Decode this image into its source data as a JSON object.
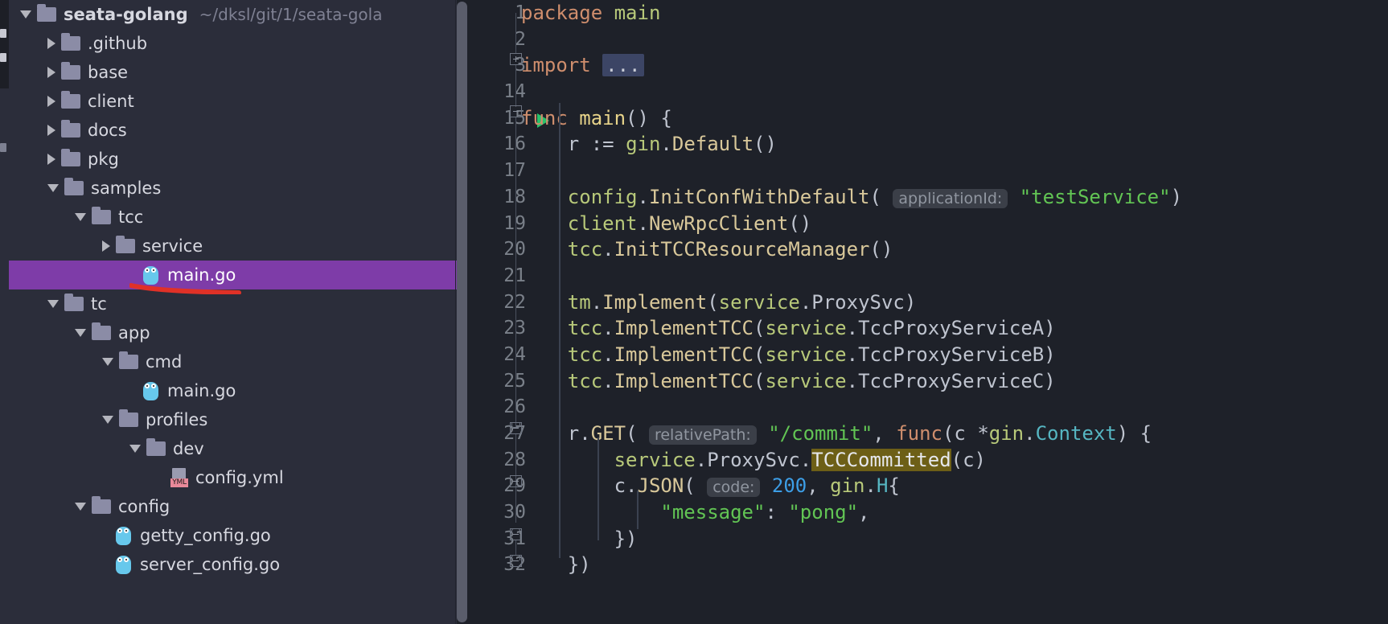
{
  "theme": {
    "sidebar_bg": "#2b2d3a",
    "editor_bg": "#1e2129",
    "selection_bg": "#7e3ca8",
    "annotation_color": "#e03127",
    "search_highlight_bg": "#6d5f17",
    "run_marker_color": "#29c36b"
  },
  "sidebar": {
    "name": "project-tree",
    "items": [
      {
        "label": "seata-golang",
        "path": "~/dksl/git/1/seata-gola",
        "type": "folder",
        "arrow": "down",
        "depth": 0,
        "bold": true,
        "selected": false
      },
      {
        "label": ".github",
        "type": "folder",
        "arrow": "right",
        "depth": 1,
        "selected": false
      },
      {
        "label": "base",
        "type": "folder",
        "arrow": "right",
        "depth": 1,
        "selected": false
      },
      {
        "label": "client",
        "type": "folder",
        "arrow": "right",
        "depth": 1,
        "selected": false
      },
      {
        "label": "docs",
        "type": "folder",
        "arrow": "right",
        "depth": 1,
        "selected": false
      },
      {
        "label": "pkg",
        "type": "folder",
        "arrow": "right",
        "depth": 1,
        "selected": false
      },
      {
        "label": "samples",
        "type": "folder",
        "arrow": "down",
        "depth": 1,
        "selected": false
      },
      {
        "label": "tcc",
        "type": "folder",
        "arrow": "down",
        "depth": 2,
        "selected": false
      },
      {
        "label": "service",
        "type": "folder",
        "arrow": "right",
        "depth": 3,
        "selected": false
      },
      {
        "label": "main.go",
        "type": "go",
        "arrow": "none",
        "depth": 4,
        "selected": true
      },
      {
        "label": "tc",
        "type": "folder",
        "arrow": "down",
        "depth": 1,
        "selected": false
      },
      {
        "label": "app",
        "type": "folder",
        "arrow": "down",
        "depth": 2,
        "selected": false
      },
      {
        "label": "cmd",
        "type": "folder",
        "arrow": "down",
        "depth": 3,
        "selected": false
      },
      {
        "label": "main.go",
        "type": "go",
        "arrow": "none",
        "depth": 4,
        "selected": false
      },
      {
        "label": "profiles",
        "type": "folder",
        "arrow": "down",
        "depth": 3,
        "selected": false
      },
      {
        "label": "dev",
        "type": "folder",
        "arrow": "down",
        "depth": 4,
        "selected": false
      },
      {
        "label": "config.yml",
        "type": "yml",
        "arrow": "none",
        "depth": 5,
        "selected": false
      },
      {
        "label": "config",
        "type": "folder",
        "arrow": "down",
        "depth": 2,
        "selected": false
      },
      {
        "label": "getty_config.go",
        "type": "go",
        "arrow": "none",
        "depth": 3,
        "selected": false
      },
      {
        "label": "server_config.go",
        "type": "go",
        "arrow": "none",
        "depth": 3,
        "selected": false
      }
    ]
  },
  "editor": {
    "name": "code-editor",
    "language": "go",
    "lines": [
      {
        "num": "1",
        "run": false,
        "tokens": [
          {
            "t": "package ",
            "c": "t-kw"
          },
          {
            "t": "main",
            "c": "t-pkg"
          }
        ]
      },
      {
        "num": "2",
        "run": false,
        "tokens": []
      },
      {
        "num": "3",
        "run": false,
        "tokens": [
          {
            "t": "import ",
            "c": "t-kw"
          },
          {
            "t": "...",
            "c": "collapsed"
          }
        ]
      },
      {
        "num": "14",
        "run": false,
        "tokens": []
      },
      {
        "num": "15",
        "run": true,
        "tokens": [
          {
            "t": "func ",
            "c": "t-kw"
          },
          {
            "t": "main",
            "c": "t-fnname"
          },
          {
            "t": "() {",
            "c": "t-punct"
          }
        ]
      },
      {
        "num": "16",
        "run": false,
        "tokens": [
          {
            "t": "    r ",
            "c": "t-ident"
          },
          {
            "t": ":= ",
            "c": "t-punct"
          },
          {
            "t": "gin",
            "c": "t-pkg"
          },
          {
            "t": ".",
            "c": "t-punct"
          },
          {
            "t": "Default",
            "c": "t-fn"
          },
          {
            "t": "()",
            "c": "t-punct"
          }
        ]
      },
      {
        "num": "17",
        "run": false,
        "tokens": []
      },
      {
        "num": "18",
        "run": false,
        "tokens": [
          {
            "t": "    config",
            "c": "t-pkg"
          },
          {
            "t": ".",
            "c": "t-punct"
          },
          {
            "t": "InitConfWithDefault",
            "c": "t-fn"
          },
          {
            "t": "(",
            "c": "t-punct"
          },
          {
            "t": " ",
            "c": "t-punct"
          },
          {
            "t": "applicationId:",
            "c": "hint"
          },
          {
            "t": " ",
            "c": "t-punct"
          },
          {
            "t": "\"testService\"",
            "c": "t-str"
          },
          {
            "t": ")",
            "c": "t-punct"
          }
        ]
      },
      {
        "num": "19",
        "run": false,
        "tokens": [
          {
            "t": "    client",
            "c": "t-pkg"
          },
          {
            "t": ".",
            "c": "t-punct"
          },
          {
            "t": "NewRpcClient",
            "c": "t-fn"
          },
          {
            "t": "()",
            "c": "t-punct"
          }
        ]
      },
      {
        "num": "20",
        "run": false,
        "tokens": [
          {
            "t": "    tcc",
            "c": "t-pkg"
          },
          {
            "t": ".",
            "c": "t-punct"
          },
          {
            "t": "InitTCCResourceManager",
            "c": "t-fn"
          },
          {
            "t": "()",
            "c": "t-punct"
          }
        ]
      },
      {
        "num": "21",
        "run": false,
        "tokens": []
      },
      {
        "num": "22",
        "run": false,
        "tokens": [
          {
            "t": "    tm",
            "c": "t-pkg"
          },
          {
            "t": ".",
            "c": "t-punct"
          },
          {
            "t": "Implement",
            "c": "t-fn"
          },
          {
            "t": "(",
            "c": "t-punct"
          },
          {
            "t": "service",
            "c": "t-pkg"
          },
          {
            "t": ".",
            "c": "t-punct"
          },
          {
            "t": "ProxySvc",
            "c": "t-ident"
          },
          {
            "t": ")",
            "c": "t-punct"
          }
        ]
      },
      {
        "num": "23",
        "run": false,
        "tokens": [
          {
            "t": "    tcc",
            "c": "t-pkg"
          },
          {
            "t": ".",
            "c": "t-punct"
          },
          {
            "t": "ImplementTCC",
            "c": "t-fn"
          },
          {
            "t": "(",
            "c": "t-punct"
          },
          {
            "t": "service",
            "c": "t-pkg"
          },
          {
            "t": ".",
            "c": "t-punct"
          },
          {
            "t": "TccProxyServiceA",
            "c": "t-ident"
          },
          {
            "t": ")",
            "c": "t-punct"
          }
        ]
      },
      {
        "num": "24",
        "run": false,
        "tokens": [
          {
            "t": "    tcc",
            "c": "t-pkg"
          },
          {
            "t": ".",
            "c": "t-punct"
          },
          {
            "t": "ImplementTCC",
            "c": "t-fn"
          },
          {
            "t": "(",
            "c": "t-punct"
          },
          {
            "t": "service",
            "c": "t-pkg"
          },
          {
            "t": ".",
            "c": "t-punct"
          },
          {
            "t": "TccProxyServiceB",
            "c": "t-ident"
          },
          {
            "t": ")",
            "c": "t-punct"
          }
        ]
      },
      {
        "num": "25",
        "run": false,
        "tokens": [
          {
            "t": "    tcc",
            "c": "t-pkg"
          },
          {
            "t": ".",
            "c": "t-punct"
          },
          {
            "t": "ImplementTCC",
            "c": "t-fn"
          },
          {
            "t": "(",
            "c": "t-punct"
          },
          {
            "t": "service",
            "c": "t-pkg"
          },
          {
            "t": ".",
            "c": "t-punct"
          },
          {
            "t": "TccProxyServiceC",
            "c": "t-ident"
          },
          {
            "t": ")",
            "c": "t-punct"
          }
        ]
      },
      {
        "num": "26",
        "run": false,
        "tokens": []
      },
      {
        "num": "27",
        "run": false,
        "tokens": [
          {
            "t": "    r",
            "c": "t-ident"
          },
          {
            "t": ".",
            "c": "t-punct"
          },
          {
            "t": "GET",
            "c": "t-fn"
          },
          {
            "t": "(",
            "c": "t-punct"
          },
          {
            "t": " ",
            "c": "t-punct"
          },
          {
            "t": "relativePath:",
            "c": "hint"
          },
          {
            "t": " ",
            "c": "t-punct"
          },
          {
            "t": "\"/commit\"",
            "c": "t-str"
          },
          {
            "t": ", ",
            "c": "t-punct"
          },
          {
            "t": "func",
            "c": "t-kw"
          },
          {
            "t": "(c *",
            "c": "t-punct"
          },
          {
            "t": "gin",
            "c": "t-pkg"
          },
          {
            "t": ".",
            "c": "t-punct"
          },
          {
            "t": "Context",
            "c": "t-type"
          },
          {
            "t": ") {",
            "c": "t-punct"
          }
        ]
      },
      {
        "num": "28",
        "run": false,
        "tokens": [
          {
            "t": "        service",
            "c": "t-pkg"
          },
          {
            "t": ".",
            "c": "t-punct"
          },
          {
            "t": "ProxySvc",
            "c": "t-ident"
          },
          {
            "t": ".",
            "c": "t-punct"
          },
          {
            "t": "TCCCommitted",
            "c": "searchhit"
          },
          {
            "t": "(c)",
            "c": "t-punct"
          }
        ]
      },
      {
        "num": "29",
        "run": false,
        "tokens": [
          {
            "t": "        c",
            "c": "t-ident"
          },
          {
            "t": ".",
            "c": "t-punct"
          },
          {
            "t": "JSON",
            "c": "t-fn"
          },
          {
            "t": "(",
            "c": "t-punct"
          },
          {
            "t": " ",
            "c": "t-punct"
          },
          {
            "t": "code:",
            "c": "hint"
          },
          {
            "t": " ",
            "c": "t-punct"
          },
          {
            "t": "200",
            "c": "t-num"
          },
          {
            "t": ", ",
            "c": "t-punct"
          },
          {
            "t": "gin",
            "c": "t-pkg"
          },
          {
            "t": ".",
            "c": "t-punct"
          },
          {
            "t": "H",
            "c": "t-type"
          },
          {
            "t": "{",
            "c": "t-punct"
          }
        ]
      },
      {
        "num": "30",
        "run": false,
        "tokens": [
          {
            "t": "            ",
            "c": "t-punct"
          },
          {
            "t": "\"message\"",
            "c": "t-str"
          },
          {
            "t": ": ",
            "c": "t-punct"
          },
          {
            "t": "\"pong\"",
            "c": "t-str"
          },
          {
            "t": ",",
            "c": "t-punct"
          }
        ]
      },
      {
        "num": "31",
        "run": false,
        "tokens": [
          {
            "t": "        })",
            "c": "t-punct"
          }
        ]
      },
      {
        "num": "32",
        "run": false,
        "tokens": [
          {
            "t": "    })",
            "c": "t-punct"
          }
        ]
      }
    ]
  }
}
